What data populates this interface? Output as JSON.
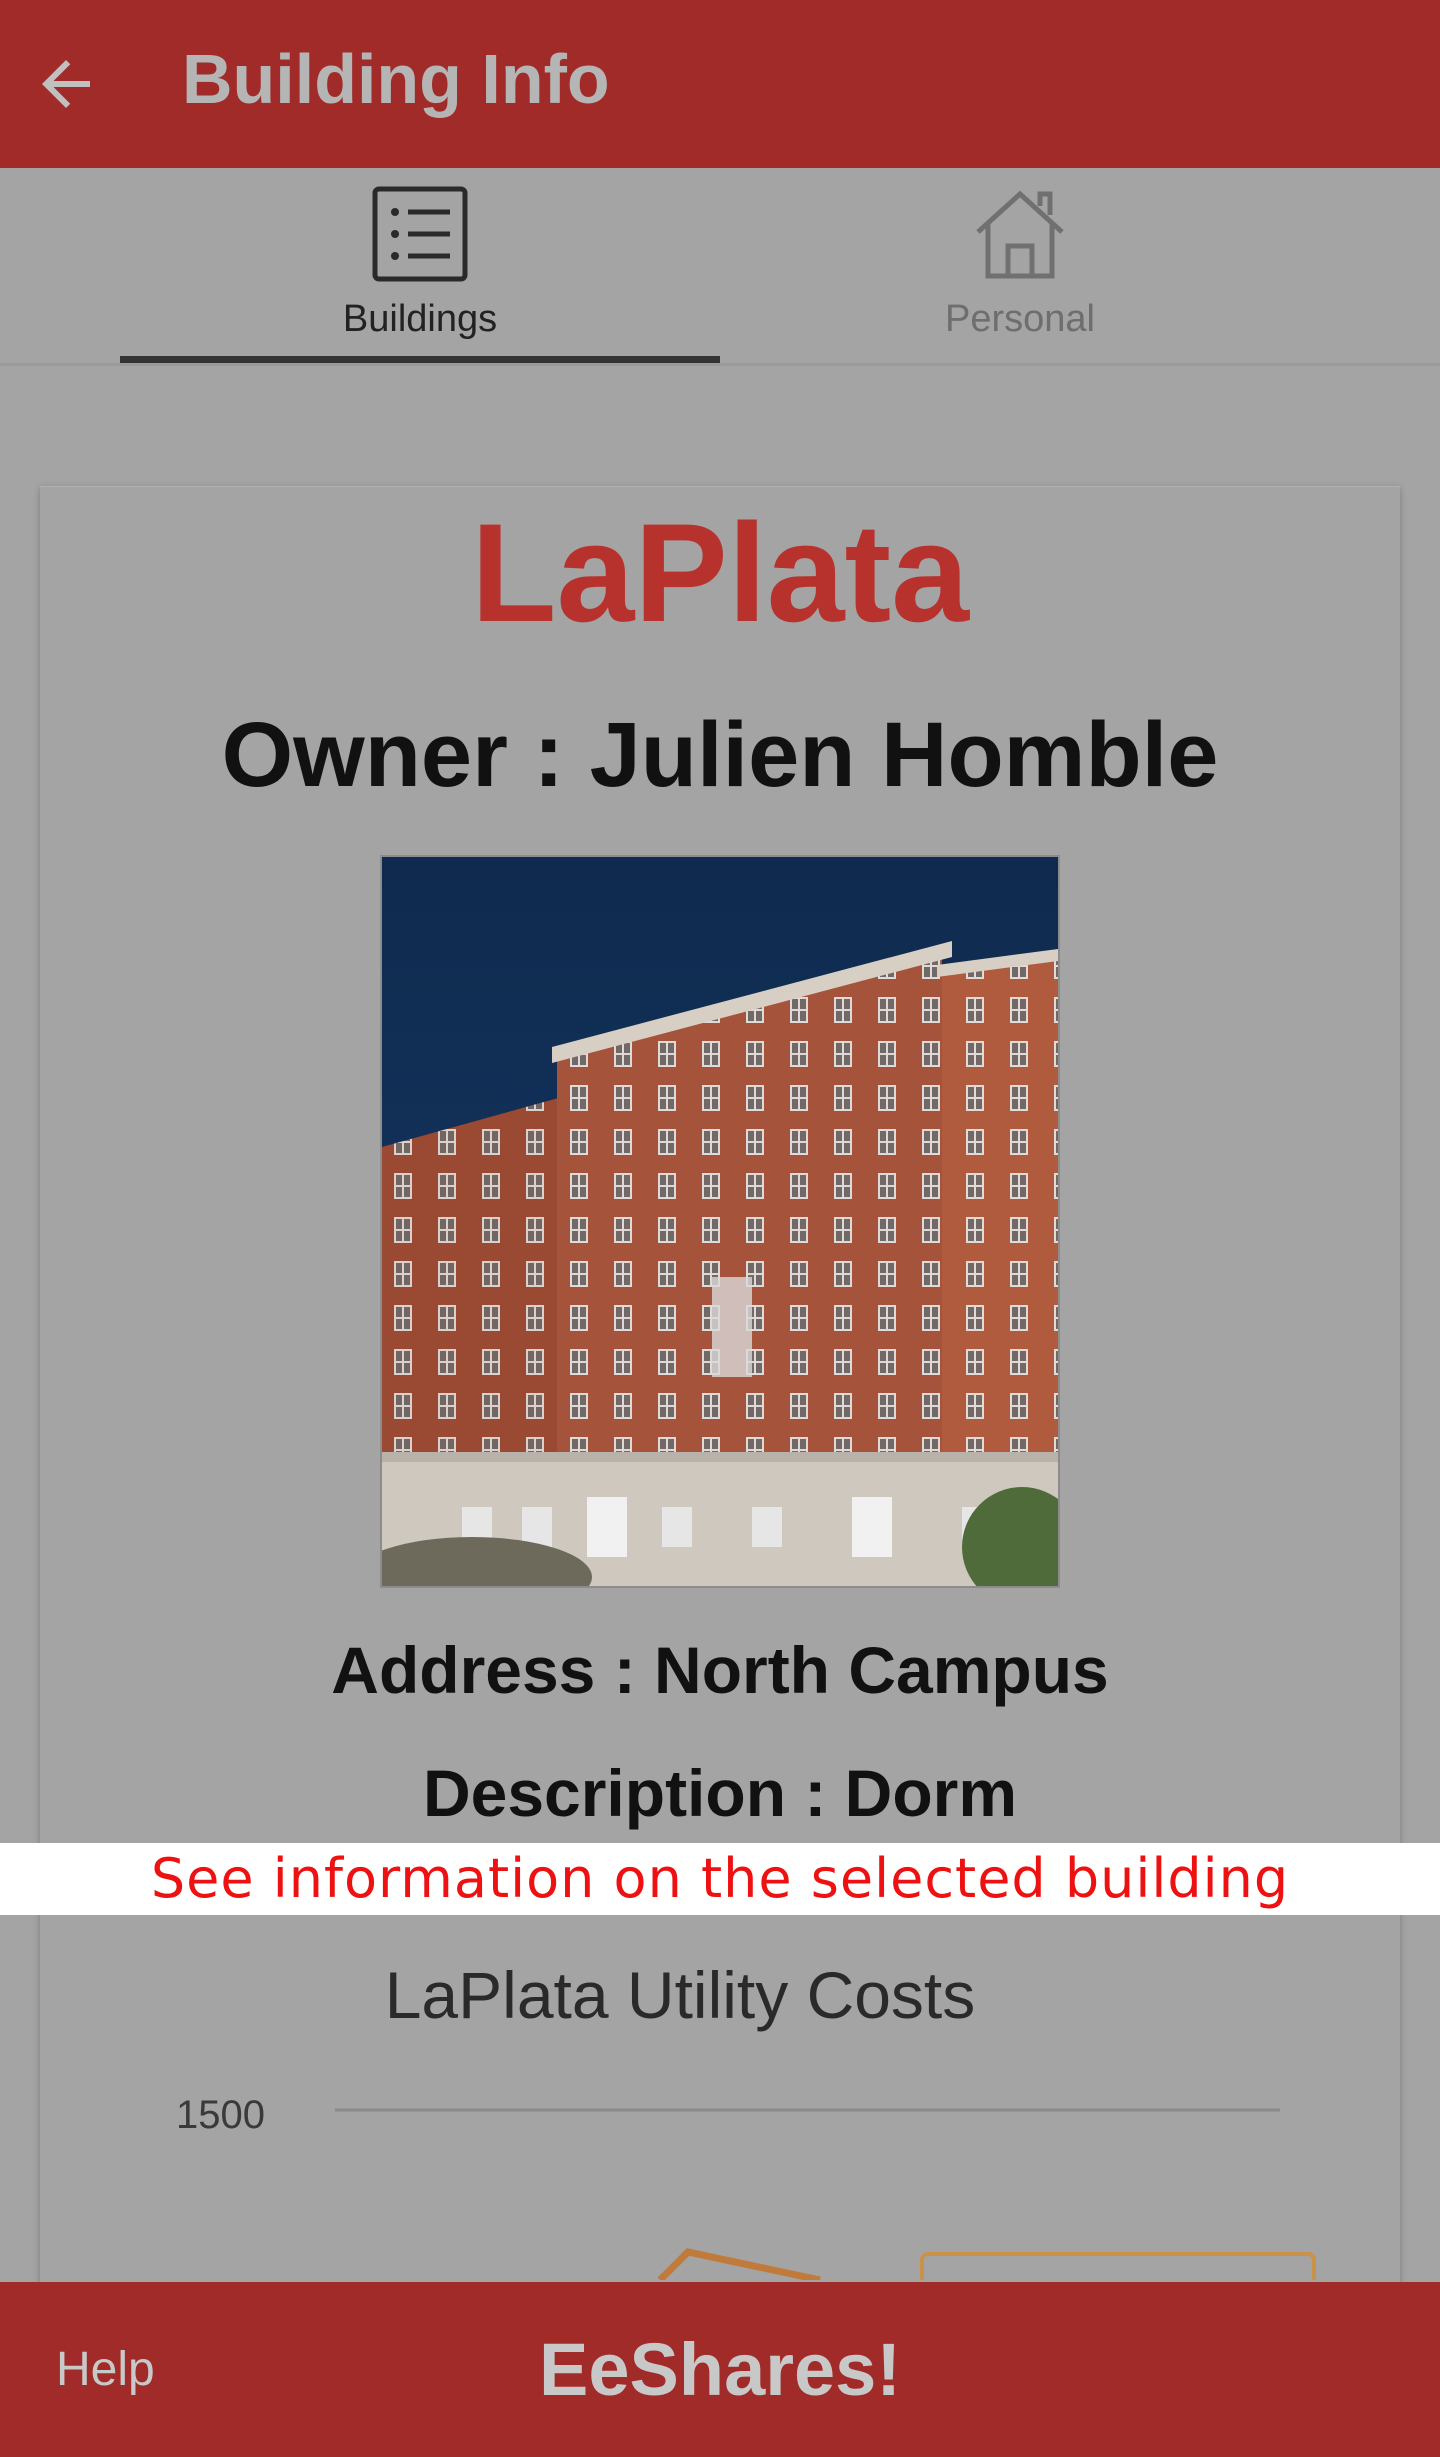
{
  "appbar": {
    "title": "Building Info",
    "back_icon": "arrow-left-icon"
  },
  "tabs": [
    {
      "label": "Buildings",
      "icon": "list-icon",
      "selected": true
    },
    {
      "label": "Personal",
      "icon": "house-icon",
      "selected": false
    }
  ],
  "building": {
    "name": "LaPlata",
    "owner": "Owner : Julien Homble",
    "address": "Address : North Campus",
    "description": "Description : Dorm"
  },
  "tooltip": "See information on the selected building",
  "chart_data": {
    "type": "line",
    "title": "LaPlata Utility Costs",
    "y_tick_labels": [
      "1500"
    ]
  },
  "bottombar": {
    "help_label": "Help",
    "brand": "EeShares!"
  },
  "colors": {
    "brand_red": "#a02b28",
    "title_red": "#b8322d",
    "tooltip_red": "#ee1111"
  }
}
